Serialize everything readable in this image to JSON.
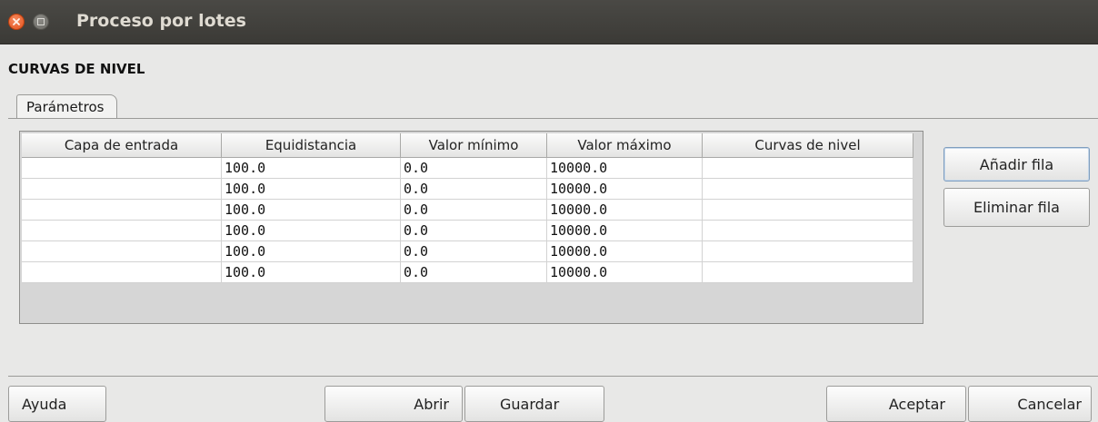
{
  "window": {
    "title": "Proceso por lotes"
  },
  "section_title": "CURVAS DE NIVEL",
  "tabs": [
    {
      "label": "Parámetros"
    }
  ],
  "table": {
    "columns": [
      "Capa de entrada",
      "Equidistancia",
      "Valor mínimo",
      "Valor máximo",
      "Curvas de nivel"
    ],
    "rows": [
      [
        "",
        "100.0",
        "0.0",
        "10000.0",
        ""
      ],
      [
        "",
        "100.0",
        "0.0",
        "10000.0",
        ""
      ],
      [
        "",
        "100.0",
        "0.0",
        "10000.0",
        ""
      ],
      [
        "",
        "100.0",
        "0.0",
        "10000.0",
        ""
      ],
      [
        "",
        "100.0",
        "0.0",
        "10000.0",
        ""
      ],
      [
        "",
        "100.0",
        "0.0",
        "10000.0",
        ""
      ]
    ]
  },
  "side_buttons": {
    "add_row": "Añadir fila",
    "remove_row": "Eliminar fila"
  },
  "footer_buttons": {
    "help": "Ayuda",
    "open": "Abrir",
    "save": "Guardar",
    "accept": "Aceptar",
    "cancel": "Cancelar"
  },
  "colors": {
    "titlebar": "#3c3b37",
    "close": "#e4521d",
    "background": "#e8e8e7"
  }
}
